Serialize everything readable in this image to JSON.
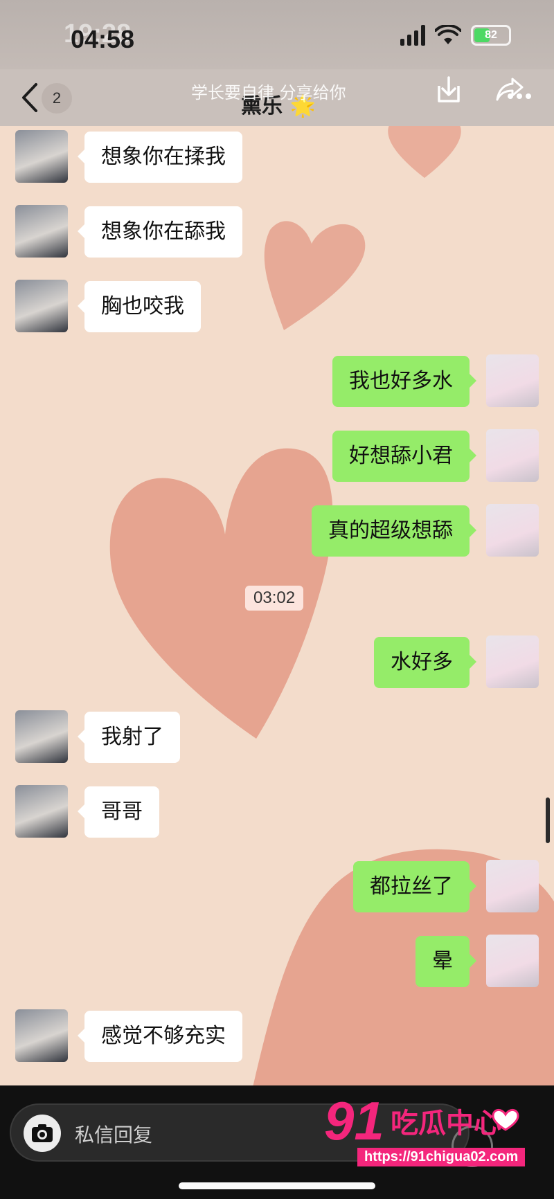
{
  "status_bar": {
    "time": "04:58",
    "ghost_time": "19:28",
    "battery_level": "82"
  },
  "nav": {
    "title": "熏乐",
    "title_emoji": "🌟",
    "unread_count": "2",
    "share_banner": "学长要自律 分享给你"
  },
  "messages": [
    {
      "side": "in",
      "text": "想象你在揉我"
    },
    {
      "side": "in",
      "text": "想象你在舔我"
    },
    {
      "side": "in",
      "text": "胸也咬我"
    },
    {
      "side": "out",
      "text": "我也好多水"
    },
    {
      "side": "out",
      "text": "好想舔小君"
    },
    {
      "side": "out",
      "text": "真的超级想舔"
    },
    {
      "side": "out",
      "text": "水好多"
    },
    {
      "side": "in",
      "text": "我射了"
    },
    {
      "side": "in",
      "text": "哥哥"
    },
    {
      "side": "out",
      "text": "都拉丝了"
    },
    {
      "side": "out",
      "text": "晕"
    },
    {
      "side": "in",
      "text": "感觉不够充实"
    }
  ],
  "timestamp": "03:02",
  "input": {
    "placeholder": "私信回复"
  },
  "watermark": {
    "logo_text": "91吃瓜中心",
    "url": "https://91chigua02.com"
  },
  "colors": {
    "incoming_bubble": "#ffffff",
    "outgoing_bubble": "#95ec69",
    "chat_background": "#f3dccb",
    "watermark_pink": "#f4267c"
  },
  "icons": [
    "back-icon",
    "download-icon",
    "share-icon",
    "more-icon",
    "camera-icon",
    "emoji-icon",
    "wifi-icon",
    "signal-icon",
    "battery-icon"
  ]
}
